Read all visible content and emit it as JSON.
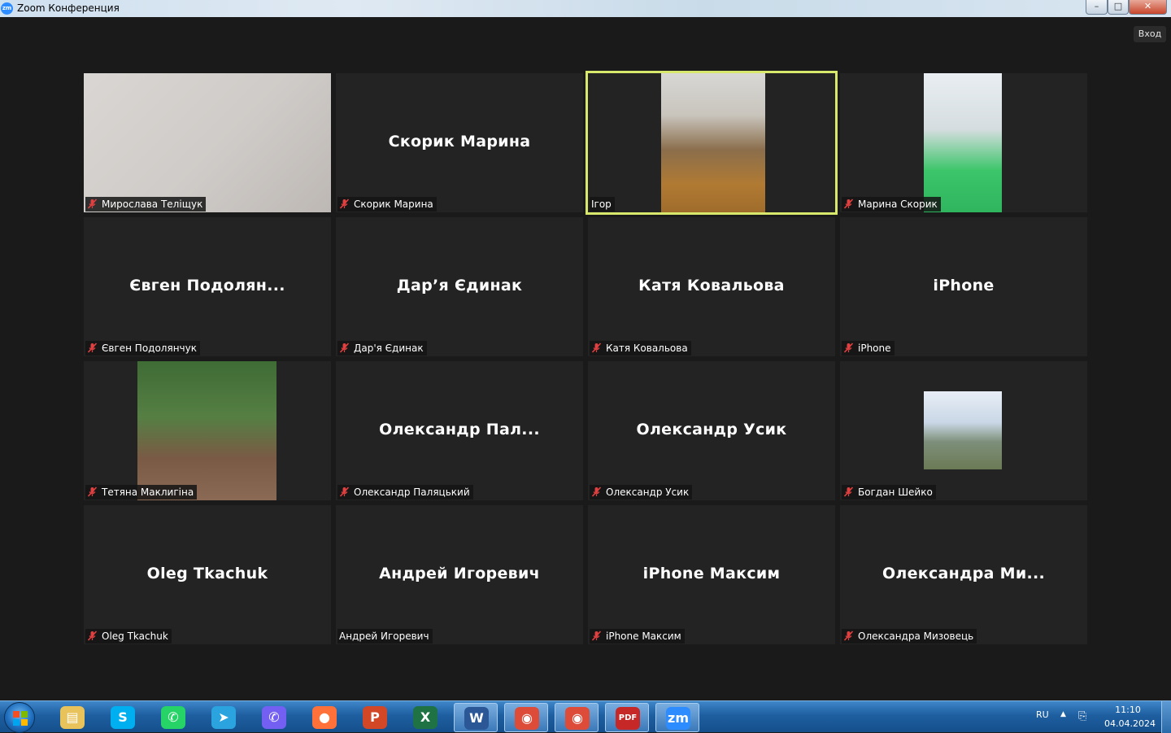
{
  "window": {
    "title": "Zoom Конференция",
    "logo": "zm",
    "controls": {
      "minimize": "–",
      "maximize": "□",
      "close": "✕"
    }
  },
  "top_right_button": "Вход",
  "tiles": [
    {
      "big_name": "",
      "label": "Мирослава Теліщук",
      "muted": true,
      "video": true
    },
    {
      "big_name": "Скорик Марина",
      "label": "Скорик Марина",
      "muted": true,
      "video": false
    },
    {
      "big_name": "",
      "label": "Ігор",
      "muted": false,
      "video": true,
      "speaking": true
    },
    {
      "big_name": "",
      "label": "Марина Скорик",
      "muted": true,
      "video": true
    },
    {
      "big_name": "Євген  Подолян...",
      "label": "Євген Подолянчук",
      "muted": true,
      "video": false
    },
    {
      "big_name": "Дар’я Єдинак",
      "label": "Дар'я Єдинак",
      "muted": true,
      "video": false
    },
    {
      "big_name": "Катя Ковальова",
      "label": "Катя Ковальова",
      "muted": true,
      "video": false
    },
    {
      "big_name": "iPhone",
      "label": "iPhone",
      "muted": true,
      "video": false
    },
    {
      "big_name": "",
      "label": "Тетяна Маклигіна",
      "muted": true,
      "video": true
    },
    {
      "big_name": "Олександр  Пал...",
      "label": "Олександр Паляцький",
      "muted": true,
      "video": false
    },
    {
      "big_name": "Олександр Усик",
      "label": "Олександр Усик",
      "muted": true,
      "video": false
    },
    {
      "big_name": "",
      "label": "Богдан Шейко",
      "muted": true,
      "video": true
    },
    {
      "big_name": "Oleg Tkachuk",
      "label": "Oleg Tkachuk",
      "muted": true,
      "video": false
    },
    {
      "big_name": "Андрей Игоревич",
      "label": "Андрей Игоревич",
      "muted": false,
      "video": false
    },
    {
      "big_name": "iPhone Максим",
      "label": "iPhone Максим",
      "muted": true,
      "video": false
    },
    {
      "big_name": "Олександра  Ми...",
      "label": "Олександра Мизовець",
      "muted": true,
      "video": false
    }
  ],
  "taskbar": {
    "apps": [
      {
        "name": "file-explorer",
        "glyph": "▤",
        "color": "#e8c25a"
      },
      {
        "name": "skype",
        "glyph": "S",
        "color": "#00aff0"
      },
      {
        "name": "whatsapp",
        "glyph": "✆",
        "color": "#25d366"
      },
      {
        "name": "telegram",
        "glyph": "➤",
        "color": "#2aa3df"
      },
      {
        "name": "viber",
        "glyph": "✆",
        "color": "#7360f2"
      },
      {
        "name": "firefox",
        "glyph": "●",
        "color": "#ff7139"
      },
      {
        "name": "powerpoint",
        "glyph": "P",
        "color": "#d24726"
      },
      {
        "name": "excel",
        "glyph": "X",
        "color": "#1f7244"
      },
      {
        "name": "word",
        "glyph": "W",
        "color": "#2b5797"
      },
      {
        "name": "chrome",
        "glyph": "◉",
        "color": "#dd4b39"
      },
      {
        "name": "chrome-profile",
        "glyph": "◉",
        "color": "#dd4b39"
      },
      {
        "name": "pdf-reader",
        "glyph": "PDF",
        "color": "#c62828"
      },
      {
        "name": "zoom",
        "glyph": "zm",
        "color": "#2d8cff"
      }
    ],
    "language": "RU",
    "time": "11:10",
    "date": "04.04.2024"
  }
}
